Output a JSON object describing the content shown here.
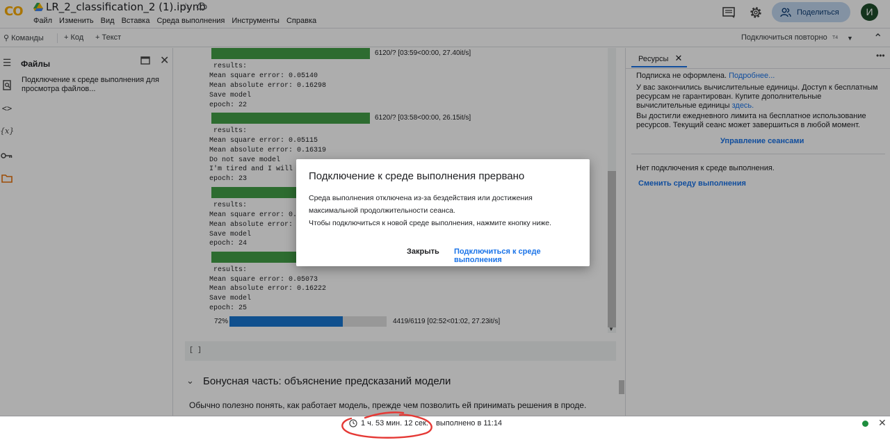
{
  "header": {
    "logo": "CO",
    "notebook_title": "LR_2_classification_2 (1).ipynb",
    "menu": [
      "Файл",
      "Изменить",
      "Вид",
      "Вставка",
      "Среда выполнения",
      "Инструменты",
      "Справка"
    ],
    "share_label": "Поделиться",
    "avatar_letter": "И"
  },
  "toolbar": {
    "commands": "Команды",
    "add_code": "+ Код",
    "add_text": "+ Текст",
    "reconnect": "Подключиться повторно",
    "runtime_type": "T4"
  },
  "files": {
    "title": "Файлы",
    "message": "Подключение к среде выполнения для просмотра файлов..."
  },
  "output": {
    "epochs": [
      {
        "progress_text": "6120/? [03:59<00:00, 27.40it/s]",
        "lines": [
          "results:",
          "Mean square error: 0.05140",
          "Mean absolute error: 0.16298",
          "Save model",
          "epoch: 22"
        ]
      },
      {
        "progress_text": "6120/? [03:58<00:00, 26.15it/s]",
        "lines": [
          "results:",
          "Mean square error: 0.05115",
          "Mean absolute error: 0.16319",
          "Do not save model",
          "I'm tired and I will s",
          "epoch: 23"
        ]
      },
      {
        "lines": [
          "results:",
          "Mean square error: 0.0",
          "Mean absolute error: 0",
          "Save model",
          "epoch: 24"
        ]
      },
      {
        "lines": [
          "results:",
          "Mean square error: 0.05073",
          "Mean absolute error: 0.16222",
          "Save model",
          "epoch: 25"
        ]
      }
    ],
    "current_progress": {
      "percent_label": "72%",
      "fraction": 0.72,
      "text": "4419/6119 [02:52<01:02, 27.23it/s]"
    }
  },
  "cells": {
    "empty_cell_label": "[ ]",
    "bonus_heading": "Бонусная часть: объяснение предсказаний модели",
    "intro_text": "Обычно полезно понять, как работает модель, прежде чем позволить ей принимать решения в проде."
  },
  "resources": {
    "tab_label": "Ресурсы",
    "subscription": "Подписка не оформлена.",
    "subscription_link": "Подробнее...",
    "units_text": "У вас закончились вычислительные единицы. Доступ к бесплатным ресурсам не гарантирован. Купите дополнительные вычислительные единицы",
    "units_link": "здесь.",
    "limit_text": "Вы достигли ежедневного лимита на бесплатное использование ресурсов. Текущий сеанс может завершиться в любой момент.",
    "manage_sessions": "Управление сеансами",
    "no_connection": "Нет подключения к среде выполнения.",
    "change_runtime": "Сменить среду выполнения"
  },
  "status_bar": {
    "elapsed": "1 ч. 53 мин. 12 сек.",
    "completed": "выполнено в 11:14"
  },
  "dialog": {
    "title": "Подключение к среде выполнения прервано",
    "body_line1": "Среда выполнения отключена из-за бездействия или достижения",
    "body_line2": "максимальной продолжительности сеанса.",
    "body_line3": "Чтобы подключиться к новой среде выполнения, нажмите кнопку ниже.",
    "close_label": "Закрыть",
    "connect_label": "Подключиться к среде выполнения"
  },
  "colors": {
    "progress_green": "#43a047",
    "progress_blue": "#1976d2",
    "accent": "#1a73e8",
    "annotation_red": "#e53935"
  }
}
